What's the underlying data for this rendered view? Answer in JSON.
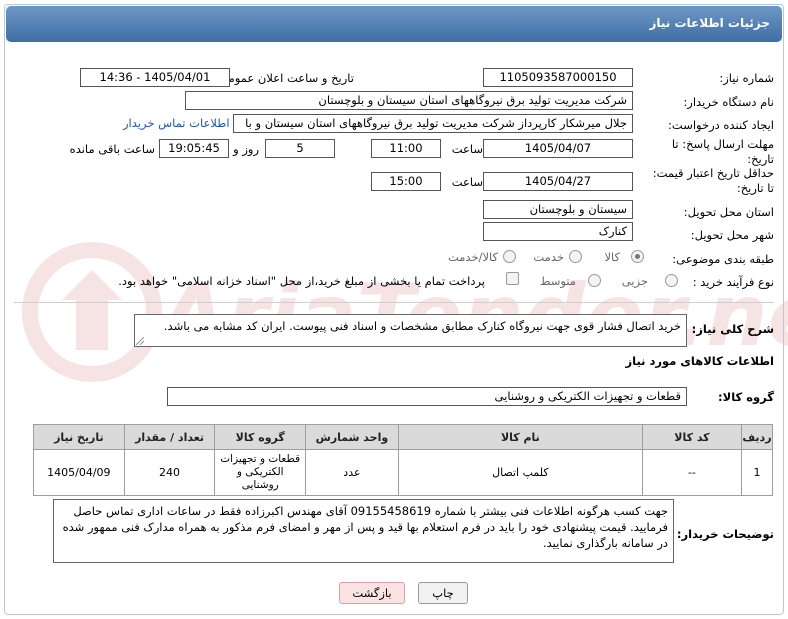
{
  "header": {
    "title": "جزئیات اطلاعات نیاز"
  },
  "form": {
    "need_number": {
      "label": "شماره نیاز:",
      "value": "1105093587000150"
    },
    "announce_datetime": {
      "label": "تاریخ و ساعت اعلان عمومی:",
      "value": "1405/04/01 - 14:36"
    },
    "buyer_org": {
      "label": "نام دستگاه خریدار:",
      "value": "شرکت مدیریت تولید برق نیروگاههای استان سیستان و بلوچستان"
    },
    "requester": {
      "label": "ایجاد کننده درخواست:",
      "value": "جلال میرشکار کارپرداز شرکت مدیریت تولید برق نیروگاههای استان سیستان و با",
      "contact_link": "اطلاعات تماس خریدار"
    },
    "reply_deadline": {
      "label_line1": "مهلت ارسال پاسخ: تا",
      "label_line2": "تاریخ:",
      "date": "1405/04/07",
      "time_label": "ساعت",
      "time": "11:00",
      "days": "5",
      "days_label": "روز و",
      "remaining": "19:05:45",
      "remaining_label": "ساعت باقی مانده"
    },
    "price_validity": {
      "label_line1": "حداقل تاریخ اعتبار قیمت:",
      "label_line2": "تا تاریخ:",
      "date": "1405/04/27",
      "time_label": "ساعت",
      "time": "15:00"
    },
    "delivery_province": {
      "label": "استان محل تحویل:",
      "value": "سیستان و بلوچستان"
    },
    "delivery_city": {
      "label": "شهر محل تحویل:",
      "value": "کنارک"
    },
    "category": {
      "label": "طبقه بندی موضوعی:",
      "options": [
        "کالا",
        "خدمت",
        "کالا/خدمت"
      ]
    },
    "process_type": {
      "label": "نوع فرآیند خرید :",
      "options": [
        "جزیی",
        "متوسط"
      ],
      "payment_note": "پرداخت تمام یا بخشی از مبلغ خرید،از محل \"اسناد خزانه اسلامی\" خواهد بود."
    }
  },
  "description": {
    "label": "شرح کلی نیاز:",
    "value": "خرید اتصال فشار قوی جهت نیروگاه کنارک مطابق مشخصات و اسناد فنی پیوست. ایران کد مشابه می باشد."
  },
  "goods_section": {
    "title": "اطلاعات کالاهای مورد نیاز",
    "group_label": "گروه کالا:",
    "group_value": "قطعات و تجهیزات الکتریکی و روشنایی"
  },
  "table": {
    "headers": [
      "ردیف",
      "کد کالا",
      "نام کالا",
      "واحد شمارش",
      "گروه کالا",
      "تعداد / مقدار",
      "تاریخ نیاز"
    ],
    "rows": [
      [
        "1",
        "--",
        "کلمپ اتصال",
        "عدد",
        "قطعات و تجهیزات الکتریکی و روشنایی",
        "240",
        "1405/04/09"
      ]
    ]
  },
  "buyer_notes": {
    "label": "توضیحات خریدار:",
    "value": "جهت کسب هرگونه اطلاعات فنی بیشتر با شماره 09155458619 آقای مهندس اکبرزاده فقط در ساعات اداری تماس حاصل فرمایید. قیمت پیشنهادی خود را باید در فرم استعلام بها قید و پس از مهر و امضای فرم مذکور به همراه مدارک فنی ممهور شده در سامانه بارگذاری نمایید."
  },
  "buttons": {
    "print": "چاپ",
    "back": "بازگشت"
  },
  "watermark": {
    "text": "AriaTender.net"
  },
  "colors": {
    "title_bar": "#3f6ea5",
    "link": "#1a56b8",
    "back_button_bg": "#fbe3e3",
    "watermark": "#e8b3b3"
  }
}
